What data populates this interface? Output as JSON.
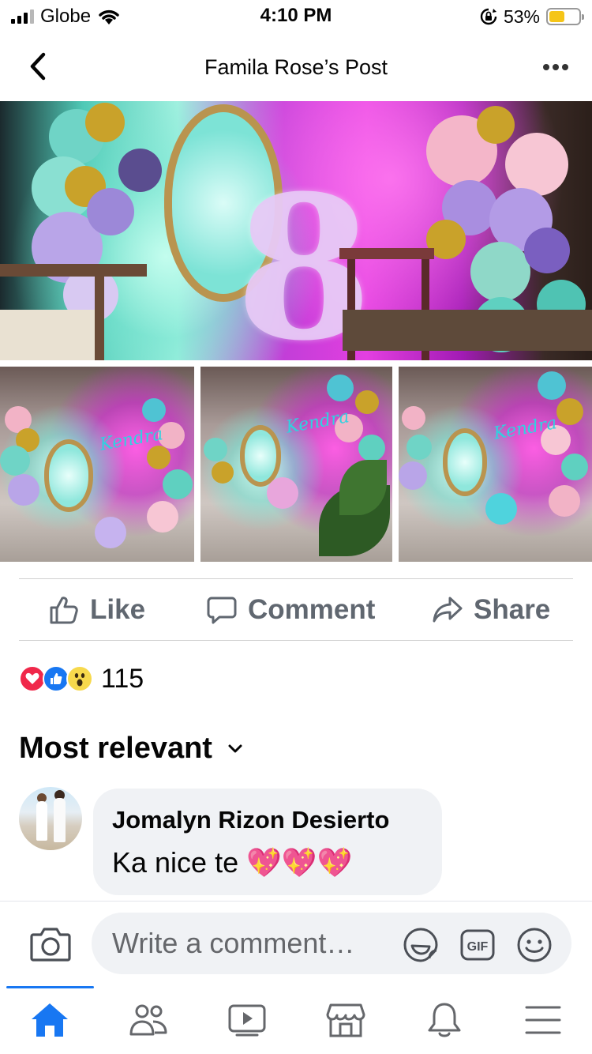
{
  "status_bar": {
    "carrier": "Globe",
    "time": "4:10 PM",
    "battery_percent": "53%",
    "battery_level": 0.53,
    "icons": [
      "signal-icon",
      "wifi-icon",
      "rotation-lock-icon",
      "battery-icon"
    ]
  },
  "header": {
    "title": "Famila Rose’s Post",
    "back_icon": "chevron-left-icon",
    "more_icon": "more-horizontal-icon"
  },
  "post": {
    "photos": {
      "main_alt": "Balloon party backdrop",
      "thumbnail_name": "Kendra",
      "thumbnail_count": 3
    }
  },
  "actions": {
    "like": "Like",
    "comment": "Comment",
    "share": "Share"
  },
  "reactions": {
    "types": [
      "love",
      "like",
      "wow"
    ],
    "count": "115"
  },
  "comments": {
    "sort_label": "Most relevant",
    "items": [
      {
        "author": "Jomalyn Rizon Desierto",
        "text": "Ka nice te 💖💖💖"
      }
    ]
  },
  "composer": {
    "placeholder": "Write a comment…",
    "icons": [
      "camera-icon",
      "sticker-icon",
      "gif-icon",
      "emoji-icon"
    ]
  },
  "tabbar": {
    "tabs": [
      "home",
      "friends",
      "watch",
      "marketplace",
      "notifications",
      "menu"
    ],
    "active": "home"
  },
  "colors": {
    "accent": "#1877f2",
    "secondary_text": "#65676b",
    "bubble": "#f0f2f5"
  }
}
